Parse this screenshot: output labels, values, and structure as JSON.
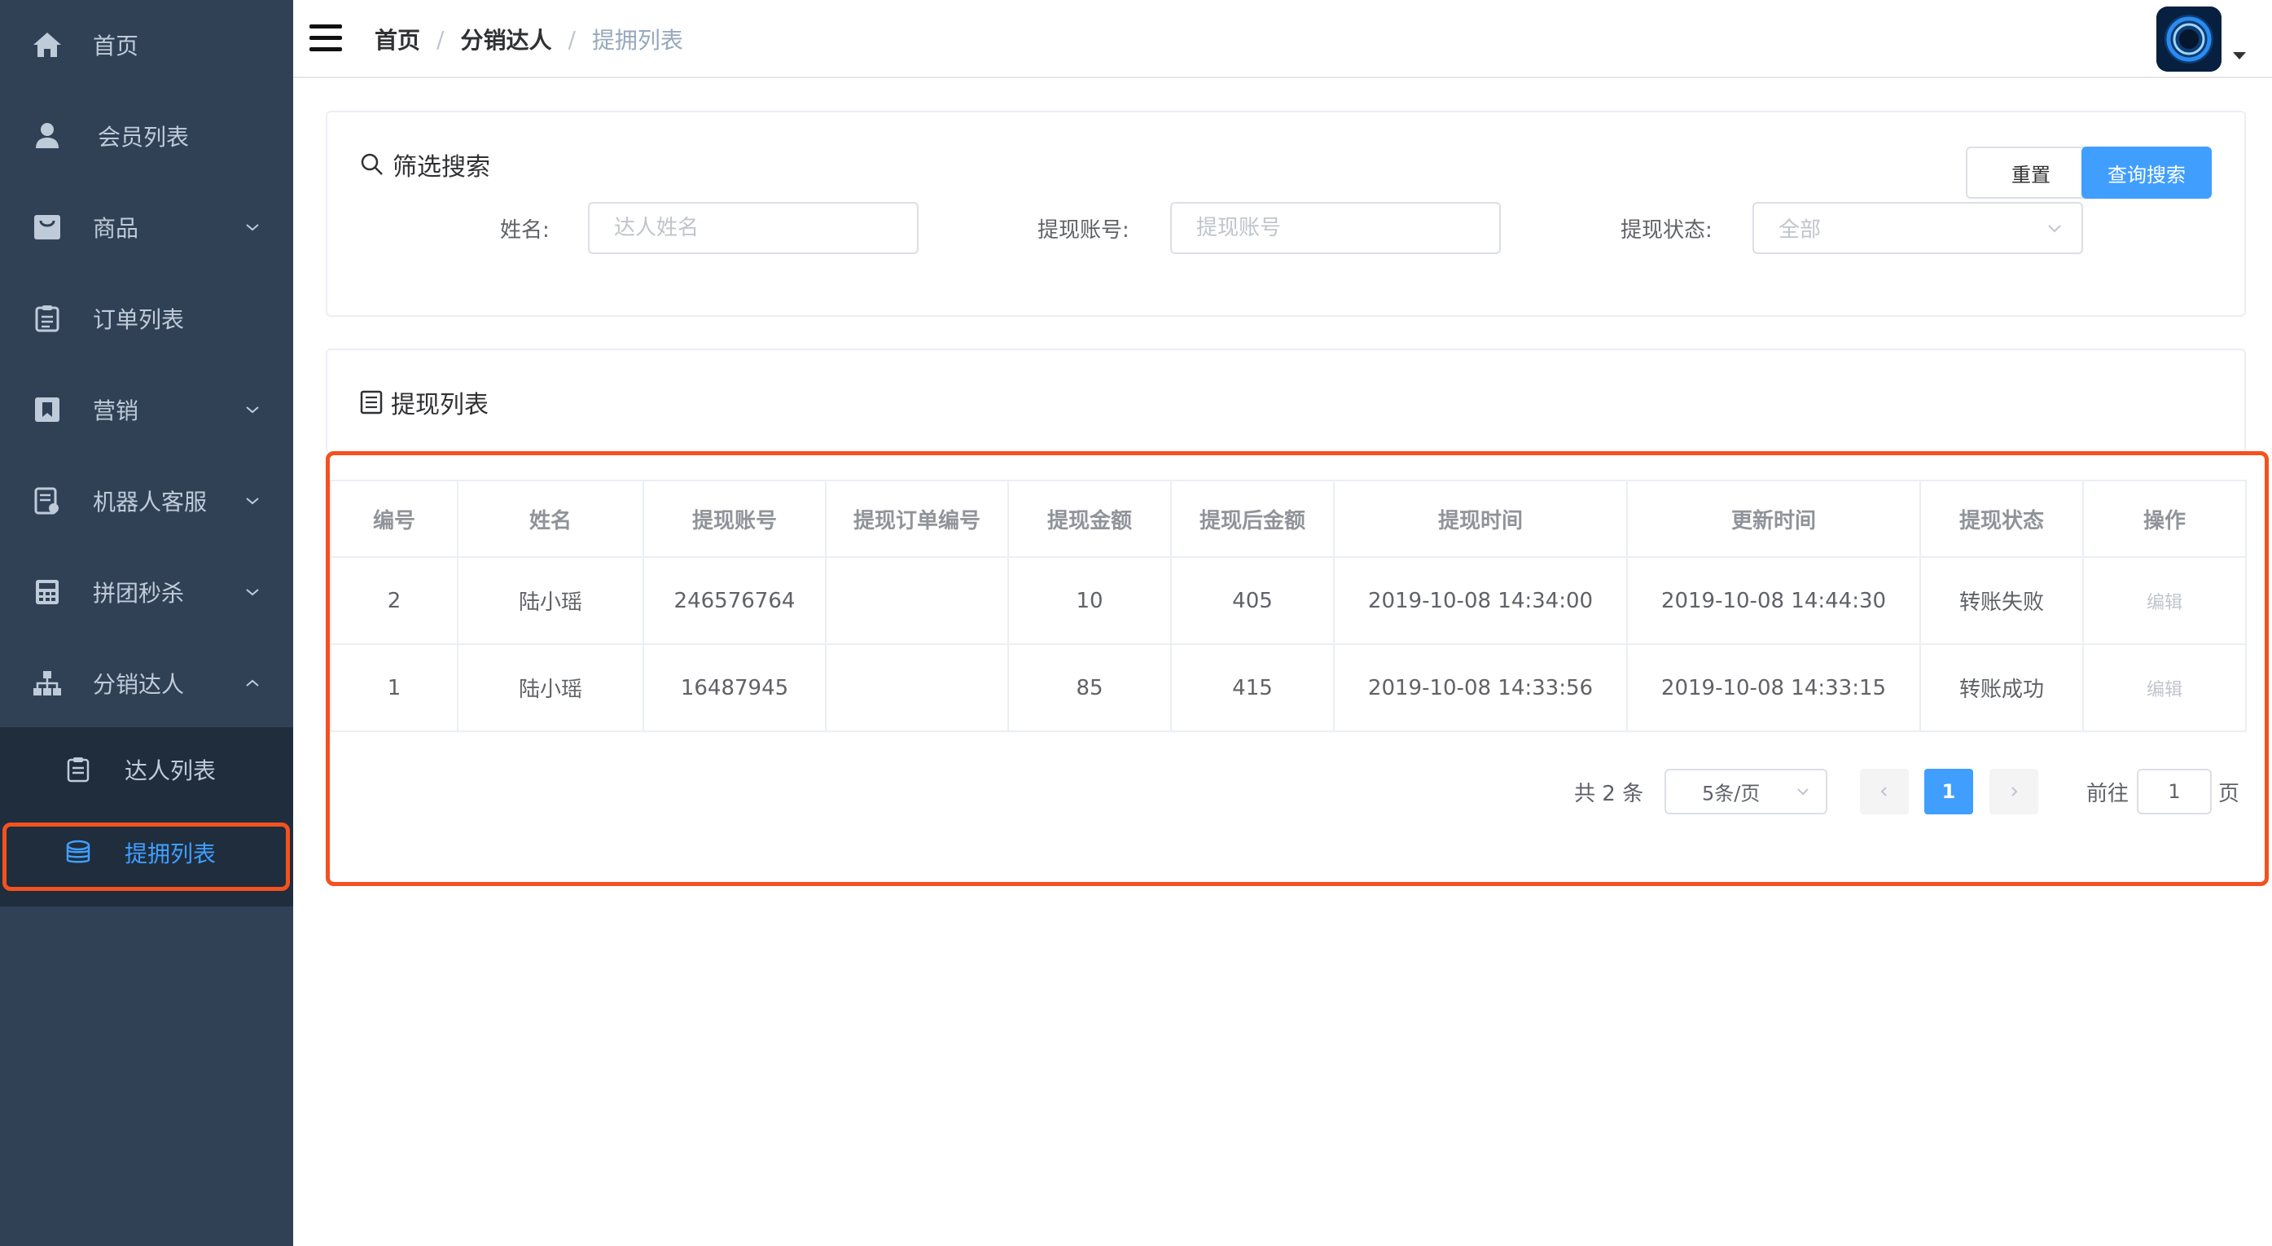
{
  "sidebar": {
    "items": [
      {
        "label": "首页",
        "icon": "home-icon"
      },
      {
        "label": "会员列表",
        "icon": "user-icon"
      },
      {
        "label": "商品",
        "icon": "bag-icon"
      },
      {
        "label": "订单列表",
        "icon": "clipboard-icon"
      },
      {
        "label": "营销",
        "icon": "bookmark-icon"
      },
      {
        "label": "机器人客服",
        "icon": "document-icon"
      },
      {
        "label": "拼团秒杀",
        "icon": "calculator-icon"
      },
      {
        "label": "分销达人",
        "icon": "sitemap-icon"
      }
    ],
    "subitems": [
      {
        "label": "达人列表",
        "icon": "clipboard-icon"
      },
      {
        "label": "提拥列表",
        "icon": "coins-icon"
      }
    ]
  },
  "header": {
    "breadcrumb": [
      "首页",
      "分销达人",
      "提拥列表"
    ],
    "separator": "/"
  },
  "filter": {
    "title": "筛选搜索",
    "name_label": "姓名:",
    "name_placeholder": "达人姓名",
    "account_label": "提现账号:",
    "account_placeholder": "提现账号",
    "status_label": "提现状态:",
    "status_value": "全部",
    "reset_label": "重置",
    "search_label": "查询搜索"
  },
  "list": {
    "title": "提现列表",
    "columns": [
      "编号",
      "姓名",
      "提现账号",
      "提现订单编号",
      "提现金额",
      "提现后金额",
      "提现时间",
      "更新时间",
      "提现状态",
      "操作"
    ],
    "rows": [
      {
        "id": "2",
        "name": "陆小瑶",
        "account": "246576764",
        "order_no": "",
        "amount": "10",
        "after_amount": "405",
        "time": "2019-10-08 14:34:00",
        "updated": "2019-10-08 14:44:30",
        "status": "转账失败",
        "action": "编辑"
      },
      {
        "id": "1",
        "name": "陆小瑶",
        "account": "16487945",
        "order_no": "",
        "amount": "85",
        "after_amount": "415",
        "time": "2019-10-08 14:33:56",
        "updated": "2019-10-08 14:33:15",
        "status": "转账成功",
        "action": "编辑"
      }
    ]
  },
  "pagination": {
    "total": "共 2 条",
    "page_size": "5条/页",
    "current_page": "1",
    "goto_label": "前往",
    "goto_value": "1",
    "page_suffix": "页"
  },
  "colors": {
    "sidebar_bg": "#304156",
    "submenu_bg": "#1f2d3d",
    "accent": "#409eff",
    "highlight_outline": "#f4511e",
    "status_fail": "#f56c6c",
    "status_success": "#67c23a"
  }
}
